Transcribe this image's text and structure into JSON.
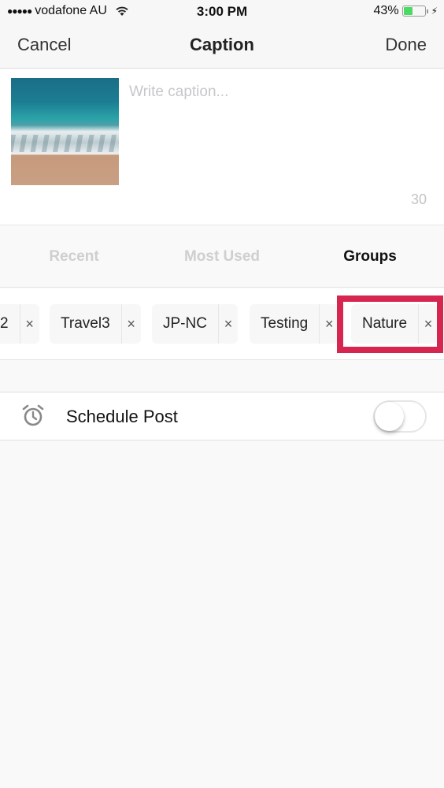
{
  "status_bar": {
    "signal_dots": "●●●●●",
    "carrier": "vodafone AU",
    "wifi_icon": "wifi-icon",
    "time": "3:00 PM",
    "battery_percent_text": "43%",
    "battery_level": 0.43,
    "charging_icon": "⚡",
    "battery_color": "#4cd964"
  },
  "nav": {
    "cancel_label": "Cancel",
    "title": "Caption",
    "done_label": "Done"
  },
  "caption": {
    "thumbnail_alt": "Beach photo with waves and sand",
    "placeholder": "Write caption...",
    "value": "",
    "char_count": "30"
  },
  "tabs": [
    {
      "label": "Recent",
      "active": false
    },
    {
      "label": "Most Used",
      "active": false
    },
    {
      "label": "Groups",
      "active": true
    }
  ],
  "groups": {
    "chips": [
      {
        "label": "2",
        "remove_icon": "×"
      },
      {
        "label": "Travel3",
        "remove_icon": "×"
      },
      {
        "label": "JP-NC",
        "remove_icon": "×"
      },
      {
        "label": "Testing",
        "remove_icon": "×"
      },
      {
        "label": "Nature",
        "remove_icon": "×",
        "highlighted": true
      }
    ],
    "highlight_color": "#d6254e"
  },
  "schedule": {
    "icon": "alarm-clock-icon",
    "label": "Schedule Post",
    "enabled": false
  }
}
